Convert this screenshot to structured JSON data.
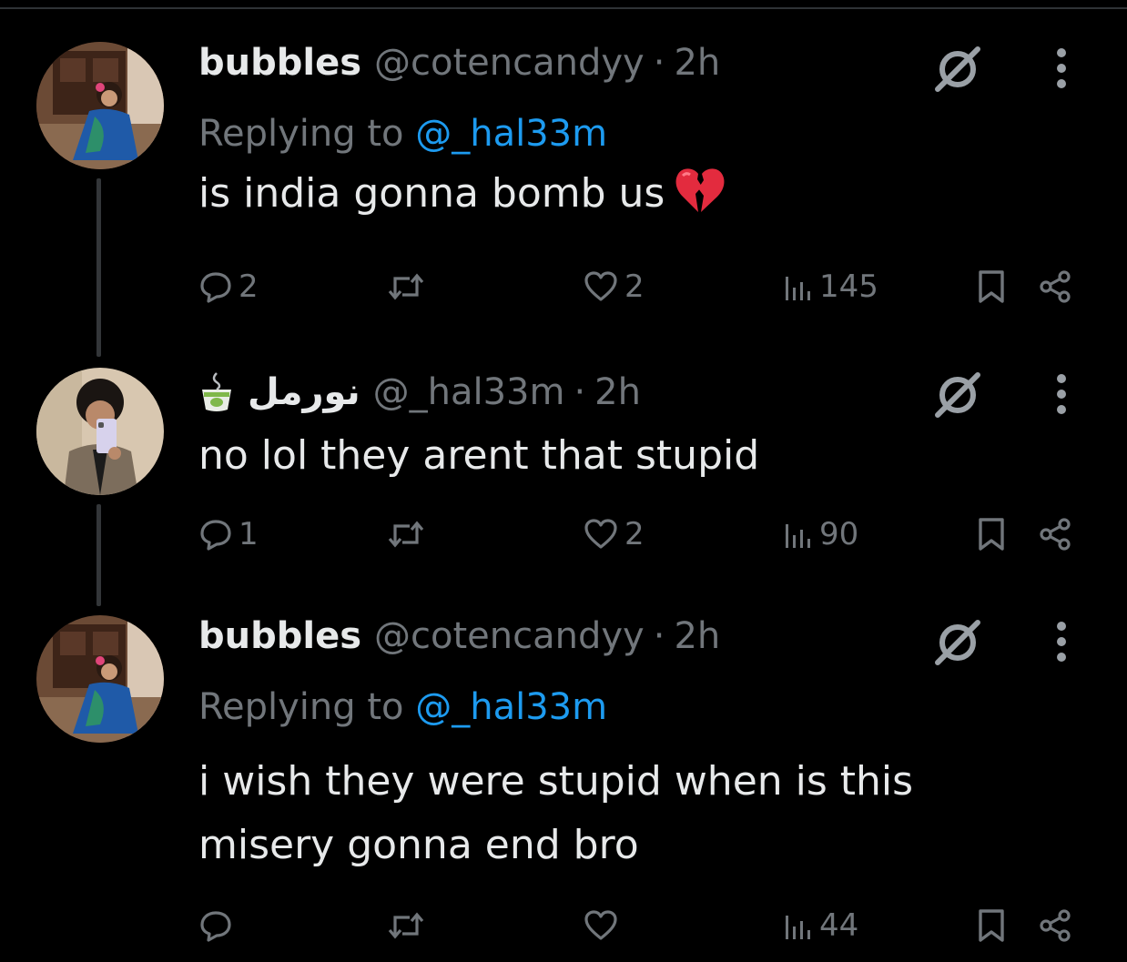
{
  "tweets": [
    {
      "display_name": "bubbles",
      "handle": "@cotencandyy",
      "separator": "·",
      "time": "2h",
      "replying_prefix": "Replying to",
      "replying_handle": "@_hal33m",
      "text": "is india gonna bomb us",
      "emoji": "broken-heart",
      "replies": "2",
      "reposts": "",
      "likes": "2",
      "views": "145"
    },
    {
      "display_name": "نورمل",
      "name_emoji": "tea-cup-icon",
      "handle": "@_hal33m",
      "separator": "·",
      "time": "2h",
      "text": "no lol they arent that stupid",
      "replies": "1",
      "reposts": "",
      "likes": "2",
      "views": "90"
    },
    {
      "display_name": "bubbles",
      "handle": "@cotencandyy",
      "separator": "·",
      "time": "2h",
      "replying_prefix": "Replying to",
      "replying_handle": "@_hal33m",
      "text_line1": "i wish they were stupid when is this",
      "text_line2": "misery gonna end bro",
      "replies": "",
      "reposts": "",
      "likes": "",
      "views": "44"
    }
  ],
  "colors": {
    "background": "#000000",
    "text": "#e7e9ea",
    "secondary": "#71767b",
    "link": "#1d9bf0",
    "thread_line": "#333639"
  },
  "icons": [
    "reply-icon",
    "repost-icon",
    "like-icon",
    "views-icon",
    "bookmark-icon",
    "share-icon",
    "grok-icon",
    "more-icon"
  ]
}
